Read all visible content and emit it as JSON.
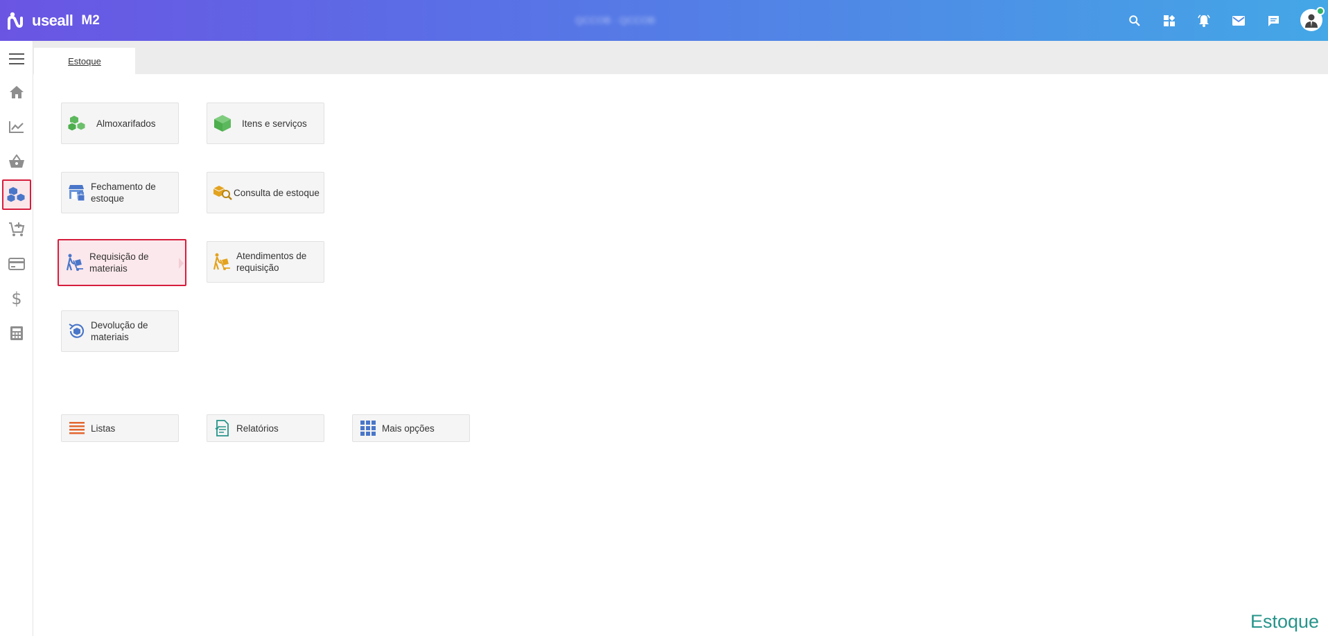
{
  "app": {
    "brand": "useall",
    "product": "M2",
    "center_text": "QCCOB · QCCOB"
  },
  "topbar": {
    "icons": [
      "search-icon",
      "apps-grid-icon",
      "alarm-bell-icon",
      "mail-icon",
      "chat-icon"
    ],
    "status_color": "#2fb36a"
  },
  "sidebar": {
    "items": [
      {
        "name": "menu",
        "icon": "hamburger-menu-icon"
      },
      {
        "name": "home",
        "icon": "home-icon"
      },
      {
        "name": "analytics",
        "icon": "trend-chart-icon"
      },
      {
        "name": "sales",
        "icon": "basket-icon"
      },
      {
        "name": "stock",
        "icon": "boxes-icon",
        "active": true
      },
      {
        "name": "purchases",
        "icon": "cart-add-icon"
      },
      {
        "name": "payments",
        "icon": "credit-card-icon"
      },
      {
        "name": "finance",
        "icon": "dollar-icon"
      },
      {
        "name": "accounting",
        "icon": "calculator-icon"
      }
    ],
    "accent": "#d61d3c"
  },
  "tabs": [
    {
      "label": "Estoque"
    }
  ],
  "tiles": {
    "almoxarifados": "Almoxarifados",
    "itens": "Itens e serviços",
    "fechamento": "Fechamento de estoque",
    "consulta": "Consulta de estoque",
    "requisicao": "Requisição de materiais",
    "atendimentos": "Atendimentos de requisição",
    "devolucao": "Devolução de materiais"
  },
  "bottom": {
    "listas": "Listas",
    "relatorios": "Relatórios",
    "mais": "Mais opções"
  },
  "footer": {
    "title": "Estoque",
    "color": "#26948a"
  }
}
